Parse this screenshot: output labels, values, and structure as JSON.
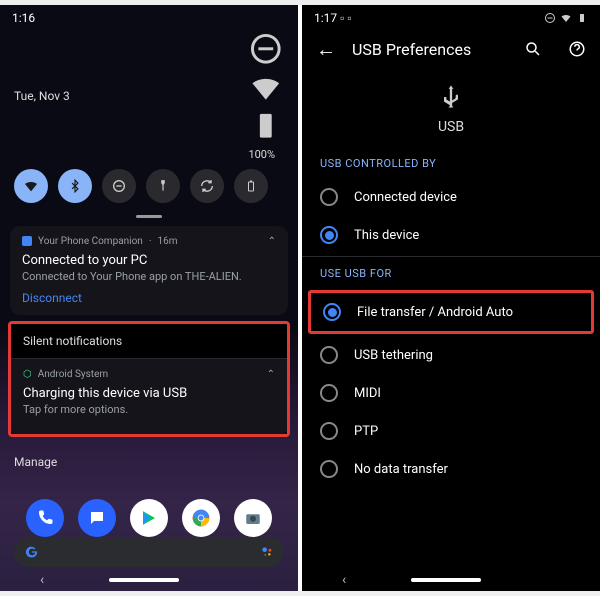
{
  "left": {
    "time": "1:16",
    "date": "Tue, Nov 3",
    "battery": "100%",
    "notif1": {
      "app": "Your Phone Companion",
      "age": "16m",
      "title": "Connected to your PC",
      "body": "Connected to Your Phone app on THE-ALIEN.",
      "action": "Disconnect"
    },
    "silent_label": "Silent notifications",
    "notif2": {
      "app": "Android System",
      "title": "Charging this device via USB",
      "body": "Tap for more options."
    },
    "manage": "Manage"
  },
  "right": {
    "time": "1:17",
    "title": "USB Preferences",
    "usb_label": "USB",
    "section1": "USB CONTROLLED BY",
    "opt_connected": "Connected device",
    "opt_this": "This device",
    "section2": "USE USB FOR",
    "opt_file": "File transfer / Android Auto",
    "opt_tether": "USB tethering",
    "opt_midi": "MIDI",
    "opt_ptp": "PTP",
    "opt_none": "No data transfer"
  }
}
